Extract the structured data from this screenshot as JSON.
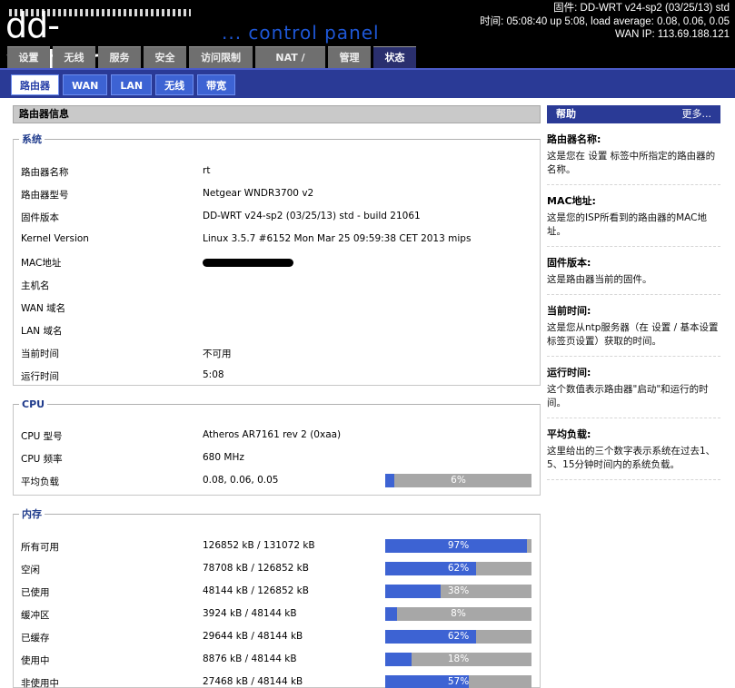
{
  "header": {
    "logo": "dd-wrt.com",
    "subtitle": "... control panel",
    "firmware_line": "固件: DD-WRT v24-sp2 (03/25/13) std",
    "time_line": "时间: 05:08:40 up 5:08, load average: 0.08, 0.06, 0.05",
    "wan_ip_line": "WAN IP: 113.69.188.121"
  },
  "main_tabs": [
    "设置",
    "无线",
    "服务",
    "安全",
    "访问限制",
    "NAT / QoS",
    "管理",
    "状态"
  ],
  "sub_tabs": [
    "路由器",
    "WAN",
    "LAN",
    "无线",
    "带宽"
  ],
  "section_title": "路由器信息",
  "system": {
    "legend": "系统",
    "rows": [
      {
        "label": "路由器名称",
        "value": "rt"
      },
      {
        "label": "路由器型号",
        "value": "Netgear WNDR3700 v2"
      },
      {
        "label": "固件版本",
        "value": "DD-WRT v24-sp2 (03/25/13) std - build 21061"
      },
      {
        "label": "Kernel Version",
        "value": "Linux 3.5.7 #6152 Mon Mar 25 09:59:38 CET 2013 mips"
      },
      {
        "label": "MAC地址",
        "value": ""
      },
      {
        "label": "主机名",
        "value": ""
      },
      {
        "label": "WAN 域名",
        "value": ""
      },
      {
        "label": "LAN 域名",
        "value": ""
      },
      {
        "label": "当前时间",
        "value": "不可用"
      },
      {
        "label": "运行时间",
        "value": "5:08"
      }
    ]
  },
  "cpu": {
    "legend": "CPU",
    "rows": [
      {
        "label": "CPU 型号",
        "value": "Atheros AR7161 rev 2 (0xaa)"
      },
      {
        "label": "CPU 频率",
        "value": "680 MHz"
      },
      {
        "label": "平均负载",
        "value": "0.08, 0.06, 0.05",
        "percent": 6,
        "percent_text": "6%"
      }
    ]
  },
  "memory": {
    "legend": "内存",
    "rows": [
      {
        "label": "所有可用",
        "value": "126852 kB / 131072 kB",
        "percent": 97,
        "percent_text": "97%"
      },
      {
        "label": "空闲",
        "value": "78708 kB / 126852 kB",
        "percent": 62,
        "percent_text": "62%"
      },
      {
        "label": "已使用",
        "value": "48144 kB / 126852 kB",
        "percent": 38,
        "percent_text": "38%"
      },
      {
        "label": "缓冲区",
        "value": "3924 kB / 48144 kB",
        "percent": 8,
        "percent_text": "8%"
      },
      {
        "label": "已缓存",
        "value": "29644 kB / 48144 kB",
        "percent": 62,
        "percent_text": "62%"
      },
      {
        "label": "使用中",
        "value": "8876 kB / 48144 kB",
        "percent": 18,
        "percent_text": "18%"
      },
      {
        "label": "非使用中",
        "value": "27468 kB / 48144 kB",
        "percent": 57,
        "percent_text": "57%"
      }
    ]
  },
  "help": {
    "title": "帮助",
    "more": "更多...",
    "items": [
      {
        "title": "路由器名称:",
        "body": "这是您在 设置 标签中所指定的路由器的名称。"
      },
      {
        "title": "MAC地址:",
        "body": "这是您的ISP所看到的路由器的MAC地址。"
      },
      {
        "title": "固件版本:",
        "body": "这是路由器当前的固件。"
      },
      {
        "title": "当前时间:",
        "body": "这是您从ntp服务器（在 设置 / 基本设置 标签页设置）获取的时间。"
      },
      {
        "title": "运行时间:",
        "body": "这个数值表示路由器\"启动\"和运行的时间。"
      },
      {
        "title": "平均负载:",
        "body": "这里给出的三个数字表示系统在过去1、5、15分钟时间内的系统负载。"
      }
    ]
  },
  "colors": {
    "accent": "#3d63d3",
    "navy": "#2a3a96",
    "bar_bg": "#a7a7a7"
  }
}
